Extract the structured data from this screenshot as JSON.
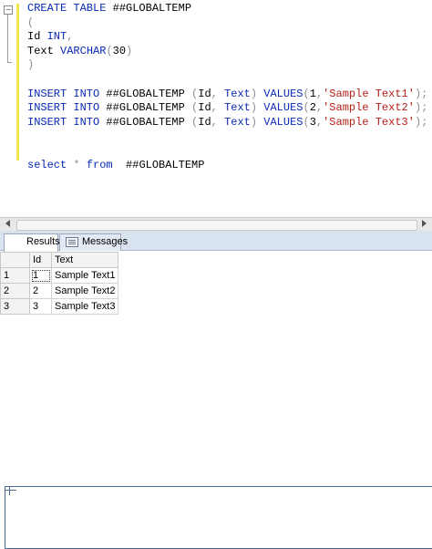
{
  "editor": {
    "lines": [
      [
        {
          "t": "CREATE TABLE ",
          "c": "kw"
        },
        {
          "t": "##GLOBALTEMP",
          "c": ""
        }
      ],
      [
        {
          "t": "(",
          "c": "op"
        }
      ],
      [
        {
          "t": "Id ",
          "c": ""
        },
        {
          "t": "INT",
          "c": "kw"
        },
        {
          "t": ",",
          "c": "op"
        }
      ],
      [
        {
          "t": "Text ",
          "c": ""
        },
        {
          "t": "VARCHAR",
          "c": "kw"
        },
        {
          "t": "(",
          "c": "op"
        },
        {
          "t": "30",
          "c": ""
        },
        {
          "t": ")",
          "c": "op"
        }
      ],
      [
        {
          "t": ")",
          "c": "op"
        }
      ],
      [
        {
          "t": "",
          "c": ""
        }
      ],
      [
        {
          "t": "INSERT INTO ",
          "c": "kw"
        },
        {
          "t": "##GLOBALTEMP ",
          "c": ""
        },
        {
          "t": "(",
          "c": "op"
        },
        {
          "t": "Id",
          "c": ""
        },
        {
          "t": ", ",
          "c": "op"
        },
        {
          "t": "Text",
          "c": "kw"
        },
        {
          "t": ") ",
          "c": "op"
        },
        {
          "t": "VALUES",
          "c": "kw"
        },
        {
          "t": "(",
          "c": "op"
        },
        {
          "t": "1",
          "c": ""
        },
        {
          "t": ",",
          "c": "op"
        },
        {
          "t": "'Sample Text1'",
          "c": "str"
        },
        {
          "t": ");",
          "c": "op"
        }
      ],
      [
        {
          "t": "INSERT INTO ",
          "c": "kw"
        },
        {
          "t": "##GLOBALTEMP ",
          "c": ""
        },
        {
          "t": "(",
          "c": "op"
        },
        {
          "t": "Id",
          "c": ""
        },
        {
          "t": ", ",
          "c": "op"
        },
        {
          "t": "Text",
          "c": "kw"
        },
        {
          "t": ") ",
          "c": "op"
        },
        {
          "t": "VALUES",
          "c": "kw"
        },
        {
          "t": "(",
          "c": "op"
        },
        {
          "t": "2",
          "c": ""
        },
        {
          "t": ",",
          "c": "op"
        },
        {
          "t": "'Sample Text2'",
          "c": "str"
        },
        {
          "t": ");",
          "c": "op"
        }
      ],
      [
        {
          "t": "INSERT INTO ",
          "c": "kw"
        },
        {
          "t": "##GLOBALTEMP ",
          "c": ""
        },
        {
          "t": "(",
          "c": "op"
        },
        {
          "t": "Id",
          "c": ""
        },
        {
          "t": ", ",
          "c": "op"
        },
        {
          "t": "Text",
          "c": "kw"
        },
        {
          "t": ") ",
          "c": "op"
        },
        {
          "t": "VALUES",
          "c": "kw"
        },
        {
          "t": "(",
          "c": "op"
        },
        {
          "t": "3",
          "c": ""
        },
        {
          "t": ",",
          "c": "op"
        },
        {
          "t": "'Sample Text3'",
          "c": "str"
        },
        {
          "t": ");",
          "c": "op"
        }
      ],
      [
        {
          "t": "",
          "c": ""
        }
      ],
      [
        {
          "t": "",
          "c": ""
        }
      ],
      [
        {
          "t": "select ",
          "c": "kw"
        },
        {
          "t": "* ",
          "c": "op"
        },
        {
          "t": "from  ",
          "c": "kw"
        },
        {
          "t": "##GLOBALTEMP",
          "c": ""
        }
      ]
    ],
    "collapse_symbol": "−"
  },
  "tabs": [
    {
      "label": "Results",
      "icon": "grid-icon",
      "active": true
    },
    {
      "label": "Messages",
      "icon": "messages-icon",
      "active": false
    }
  ],
  "results": {
    "columns": [
      "Id",
      "Text"
    ],
    "rows": [
      {
        "num": "1",
        "id": "1",
        "text": "Sample Text1"
      },
      {
        "num": "2",
        "id": "2",
        "text": "Sample Text2"
      },
      {
        "num": "3",
        "id": "3",
        "text": "Sample Text3"
      }
    ]
  },
  "colors": {
    "keyword": "#0a2ab8",
    "string": "#b3211a",
    "operator": "#8f8f8f",
    "change_bar": "#f2e84c"
  }
}
